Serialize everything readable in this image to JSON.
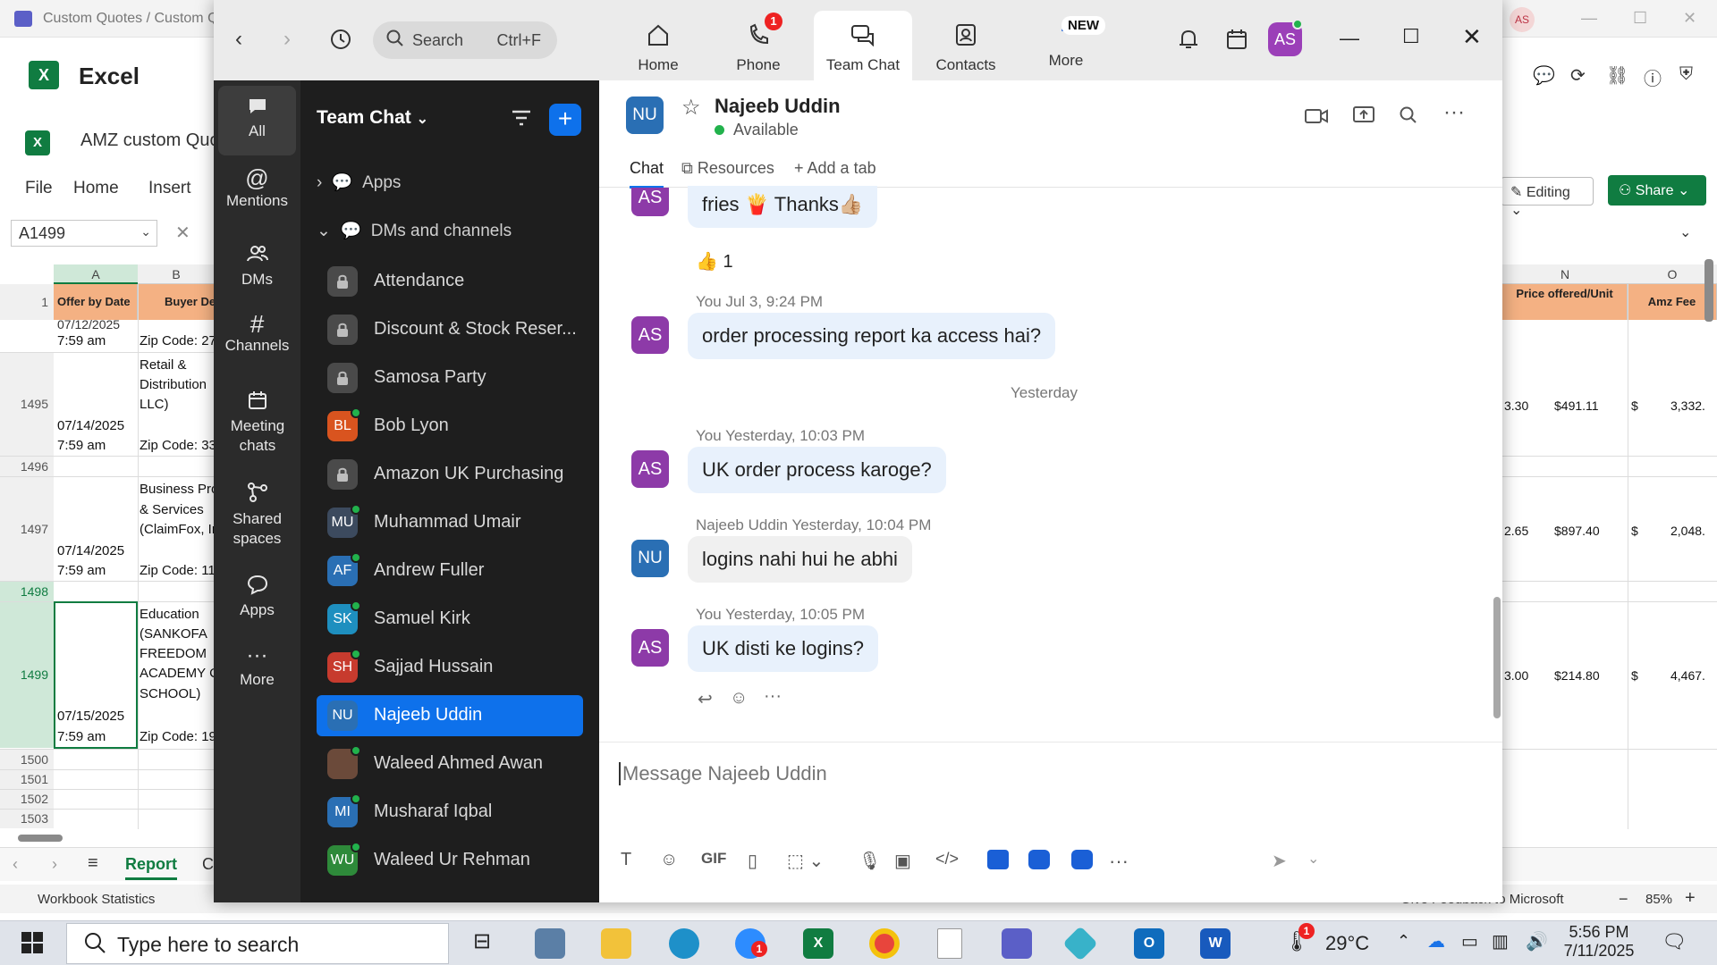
{
  "excel": {
    "title": "Custom Quotes / Custom Q",
    "app_name": "Excel",
    "file_name": "AMZ custom Quo",
    "menu": [
      "File",
      "Home",
      "Insert"
    ],
    "name_box": "A1499",
    "avatar": "AS",
    "editing_label": "Editing",
    "share_label": "Share",
    "columns": [
      "A",
      "B",
      "N",
      "O"
    ],
    "header_row": {
      "row": "1",
      "a": "Offer by Date",
      "b": "Buyer De",
      "n": "Price offered/Unit",
      "o": "Amz Fee"
    },
    "rows": [
      {
        "num": "",
        "a1": "07/12/2025",
        "a2": "7:59 am",
        "b": [
          "",
          "Zip Code: 27"
        ],
        "n": "",
        "o_sym": "",
        "o": "",
        "m": ""
      },
      {
        "num": "1495",
        "a1": "07/14/2025",
        "a2": "7:59 am",
        "b": [
          "Retail &",
          "Distribution",
          "LLC)",
          "",
          "Zip Code: 33"
        ],
        "m": "3.30",
        "n": "$491.11",
        "o_sym": "$",
        "o": "3,332."
      },
      {
        "num": "1496"
      },
      {
        "num": "1497",
        "a1": "07/14/2025",
        "a2": "7:59 am",
        "b": [
          "Business Pro",
          "& Services",
          "(ClaimFox, In",
          "",
          "Zip Code: 11"
        ],
        "m": "2.65",
        "n": "$897.40",
        "o_sym": "$",
        "o": "2,048."
      },
      {
        "num": "1498"
      },
      {
        "num": "1499",
        "a1": "07/15/2025",
        "a2": "7:59 am",
        "b": [
          "Education",
          "(SANKOFA",
          "FREEDOM",
          "ACADEMY C",
          "SCHOOL)",
          "",
          "Zip Code: 19"
        ],
        "m": "3.00",
        "n": "$214.80",
        "o_sym": "$",
        "o": "4,467."
      },
      {
        "num": "1500"
      },
      {
        "num": "1501"
      },
      {
        "num": "1502"
      },
      {
        "num": "1503"
      }
    ],
    "sheet_tab": "Report",
    "sheet_tab2": "C",
    "status_left": "Workbook Statistics",
    "status_feedback": "Give Feedback to Microsoft",
    "zoom_level": "85%"
  },
  "zoom": {
    "search": {
      "placeholder": "Search",
      "shortcut": "Ctrl+F"
    },
    "tabs": [
      {
        "label": "Home"
      },
      {
        "label": "Phone",
        "badge": "1"
      },
      {
        "label": "Team Chat"
      },
      {
        "label": "Contacts"
      },
      {
        "label": "More",
        "badge": "NEW"
      }
    ],
    "me_avatar": "AS",
    "rail": [
      "All",
      "Mentions",
      "DMs",
      "Channels",
      "Meeting chats",
      "Shared spaces",
      "Apps",
      "More"
    ],
    "list_title": "Team Chat",
    "sections": {
      "apps": "Apps",
      "dms": "DMs and channels"
    },
    "channels": [
      {
        "name": "Attendance",
        "avatar": "",
        "type": "lock"
      },
      {
        "name": "Discount & Stock Reser...",
        "avatar": "",
        "type": "lock"
      },
      {
        "name": "Samosa Party",
        "avatar": "",
        "type": "lock"
      },
      {
        "name": "Bob Lyon",
        "avatar": "BL",
        "color": "#d9541f",
        "online": true
      },
      {
        "name": "Amazon UK Purchasing",
        "avatar": "",
        "type": "lock"
      },
      {
        "name": "Muhammad Umair",
        "avatar": "MU",
        "color": "#3c4a5e",
        "online": true
      },
      {
        "name": "Andrew Fuller",
        "avatar": "AF",
        "color": "#2a6fb4",
        "online": true
      },
      {
        "name": "Samuel Kirk",
        "avatar": "SK",
        "color": "#1e8fbf",
        "online": true
      },
      {
        "name": "Sajjad Hussain",
        "avatar": "SH",
        "color": "#c73b2e",
        "online": true
      },
      {
        "name": "Najeeb Uddin",
        "avatar": "NU",
        "color": "#2a6fb4",
        "active": true
      },
      {
        "name": "Waleed Ahmed Awan",
        "avatar": "",
        "color": "#6b4a3a",
        "online": true,
        "photo": true
      },
      {
        "name": "Musharaf Iqbal",
        "avatar": "MI",
        "color": "#2a6fb4",
        "online": true
      },
      {
        "name": "Waleed Ur Rehman",
        "avatar": "WU",
        "color": "#2e8a3a",
        "online": true
      }
    ],
    "chat": {
      "contact_name": "Najeeb Uddin",
      "contact_initials": "NU",
      "status": "Available",
      "subtabs": [
        "Chat",
        "Resources",
        "Add a tab"
      ],
      "messages": [
        {
          "avatar": "AS",
          "meta": "",
          "text": "fries 🍟 Thanks👍🏼",
          "reaction": "👍 1"
        },
        {
          "avatar": "AS",
          "meta_name": "You",
          "meta_time": "Jul 3, 9:24 PM",
          "text": "order processing report ka access hai?"
        },
        {
          "avatar": "AS",
          "meta_name": "You",
          "meta_time": "Yesterday, 10:03 PM",
          "text": "UK order process karoge?"
        },
        {
          "avatar": "NU",
          "meta_name": "Najeeb Uddin",
          "meta_time": "Yesterday, 10:04 PM",
          "text": "logins nahi hui he abhi"
        },
        {
          "avatar": "AS",
          "meta_name": "You",
          "meta_time": "Yesterday, 10:05 PM",
          "text": "UK disti ke logins?"
        }
      ],
      "date_separator": "Yesterday",
      "composer_placeholder": "Message Najeeb Uddin",
      "gif_label": "GIF"
    }
  },
  "taskbar": {
    "search_placeholder": "Type here to search",
    "weather": "29°C",
    "weather_badge": "1",
    "zoom_badge": "1",
    "time": "5:56 PM",
    "date": "7/11/2025"
  }
}
